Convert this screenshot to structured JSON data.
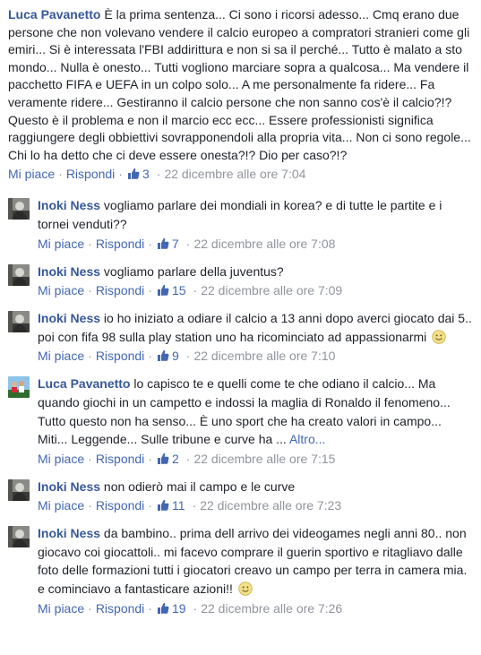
{
  "top_comment": {
    "author": "Luca Pavanetto",
    "text": "È la prima sentenza... Ci sono i ricorsi adesso... Cmq erano due persone che non volevano vendere il calcio europeo a compratori stranieri come gli emiri... Si è interessata l'FBI addirittura e non si sa il perché... Tutto è malato a sto mondo... Nulla è onesto... Tutti vogliono marciare sopra a qualcosa... Ma vendere il pacchetto FIFA e UEFA in un colpo solo... A me personalmente fa ridere... Fa veramente ridere... Gestiranno il calcio persone che non sanno cos'è il calcio?!? Questo è il problema e non il marcio ecc ecc... Essere professionisti significa raggiungere degli obbiettivi sovrapponendoli alla propria vita... Non ci sono regole... Chi lo ha detto che ci deve essere onesta?!? Dio per caso?!?",
    "like_label": "Mi piace",
    "reply_label": "Rispondi",
    "likes": "3",
    "timestamp": "22 dicembre alle ore 7:04"
  },
  "replies": [
    {
      "author": "Inoki Ness",
      "text": "vogliamo parlare dei mondiali in korea? e di tutte le partite e i tornei venduti??",
      "like_label": "Mi piace",
      "reply_label": "Rispondi",
      "likes": "7",
      "timestamp": "22 dicembre alle ore 7:08"
    },
    {
      "author": "Inoki Ness",
      "text": "vogliamo parlare della juventus?",
      "like_label": "Mi piace",
      "reply_label": "Rispondi",
      "likes": "15",
      "timestamp": "22 dicembre alle ore 7:09"
    },
    {
      "author": "Inoki Ness",
      "text": "io ho iniziato a odiare il calcio a 13 anni dopo averci giocato dai 5.. poi con fifa 98 sulla play station uno ha ricominciato ad appassionarmi",
      "like_label": "Mi piace",
      "reply_label": "Rispondi",
      "likes": "9",
      "timestamp": "22 dicembre alle ore 7:10"
    },
    {
      "author": "Luca Pavanetto",
      "text": "lo capisco te e quelli come te che odiano il calcio... Ma quando giochi in un campetto e indossi la maglia di Ronaldo il fenomeno... Tutto questo non ha senso... È uno sport che ha creato valori in campo... Miti... Leggende... Sulle tribune e curve ha ...",
      "more_label": "Altro...",
      "like_label": "Mi piace",
      "reply_label": "Rispondi",
      "likes": "2",
      "timestamp": "22 dicembre alle ore 7:15"
    },
    {
      "author": "Inoki Ness",
      "text": "non odierò mai il campo e le curve",
      "like_label": "Mi piace",
      "reply_label": "Rispondi",
      "likes": "11",
      "timestamp": "22 dicembre alle ore 7:23"
    },
    {
      "author": "Inoki Ness",
      "text": "da bambino.. prima dell arrivo dei videogames negli anni 80.. non giocavo coi giocattoli.. mi facevo comprare il guerin sportivo e ritagliavo dalle foto delle formazioni tutti i giocatori creavo un campo per terra in camera mia. e cominciavo a fantasticare azioni!!",
      "like_label": "Mi piace",
      "reply_label": "Rispondi",
      "likes": "19",
      "timestamp": "22 dicembre alle ore 7:26"
    }
  ],
  "colors": {
    "author": "#365899",
    "link": "#4267b2",
    "meta": "#90949c",
    "text": "#1d2129"
  }
}
